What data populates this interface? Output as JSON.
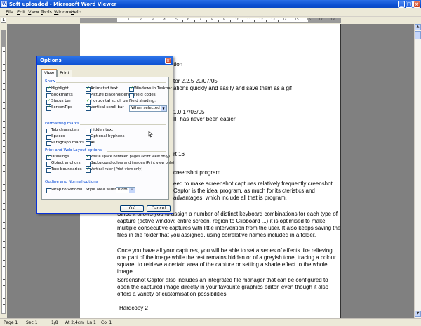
{
  "window": {
    "title": "Soft uploaded - Microsoft Word Viewer",
    "app_icon": "W",
    "buttons": {
      "minimize": "_",
      "maximize": "□",
      "close": "×"
    }
  },
  "menubar": [
    {
      "underline": "F",
      "rest": "ile"
    },
    {
      "underline": "E",
      "rest": "dit"
    },
    {
      "underline": "V",
      "rest": "iew"
    },
    {
      "underline": "T",
      "rest": "ools"
    },
    {
      "underline": "W",
      "rest": "indow"
    },
    {
      "underline": "H",
      "rest": "elp"
    }
  ],
  "ruler": {
    "corner": "L",
    "numbers": [
      "1",
      "2",
      "3",
      "4",
      "5",
      "6",
      "7",
      "8",
      "9",
      "10",
      "11",
      "12",
      "13",
      "14",
      "15",
      "16",
      "17",
      "18"
    ]
  },
  "document": {
    "lines": [
      "ormation",
      "tor 2.2.5 20/07/05",
      "ations quickly and easily and save them as a gif",
      "1.0 17/03/05",
      "IF has never been easier",
      "rt 16",
      "creenshot program"
    ],
    "para1": "eed to make screenshot captures relatively frequently creenshot Captor is the ideal program, as much for its cteristics and advantages, which include all that is program.",
    "para2": "Since it allows you to assign a number of distinct keyboard combinations for each type of capture (active window, entire screen, region to Clipboard ...) it is optimised to make multiple consecutive captures with little intervention from the user. It also keeps saving the files in the folder that you assigned, using correlative names included in a folder.",
    "para3": "Once you have all your captures, you will be able to set a series of effects like relieving one part of the image while the rest remains hidden or of a greyish tone, tracing a colour square, to retrieve a certain area of the capture or setting a shade effect to the whole image.",
    "para4": "Screenshot Captor also includes an integrated file manager that can be configured to open the captured image directly in your favourite graphics editor, even though it also offers a variety of customisation possibilities.",
    "heading": "Hardcopy 2"
  },
  "scrollbar": {
    "up": "▲",
    "down": "▼"
  },
  "dialog": {
    "title": "Options",
    "close": "×",
    "tabs": [
      "View",
      "Print"
    ],
    "show": {
      "label": "Show",
      "col1": [
        {
          "label": "Highlight",
          "checked": true
        },
        {
          "label": "Bookmarks",
          "checked": false
        },
        {
          "label": "Status bar",
          "checked": true
        },
        {
          "label": "ScreenTips",
          "checked": true
        }
      ],
      "col2": [
        {
          "label": "Animated text",
          "checked": true
        },
        {
          "label": "Picture placeholders",
          "checked": false
        },
        {
          "label": "Horizontal scroll bar",
          "checked": true
        },
        {
          "label": "Vertical scroll bar",
          "checked": true
        }
      ],
      "col3": [
        {
          "label": "Windows in Taskbar",
          "checked": true
        },
        {
          "label": "Field codes",
          "checked": false
        }
      ],
      "field_shading_label": "Field shading:",
      "field_shading_value": "When selected"
    },
    "formatting": {
      "label": "Formatting marks",
      "col1": [
        {
          "label": "Tab characters",
          "checked": false
        },
        {
          "label": "Spaces",
          "checked": false
        },
        {
          "label": "Paragraph marks",
          "checked": false
        }
      ],
      "col2": [
        {
          "label": "Hidden text",
          "checked": false
        },
        {
          "label": "Optional hyphens",
          "checked": false
        },
        {
          "label": "All",
          "checked": false
        }
      ]
    },
    "print_web": {
      "label": "Print and Web Layout options",
      "col1": [
        {
          "label": "Drawings",
          "checked": true
        },
        {
          "label": "Object anchors",
          "checked": false
        },
        {
          "label": "Text boundaries",
          "checked": false
        }
      ],
      "col2": [
        {
          "label": "White space between pages (Print view only)",
          "checked": true
        },
        {
          "label": "Background colors and images (Print view only)",
          "checked": false
        },
        {
          "label": "Vertical ruler (Print view only)",
          "checked": true
        }
      ]
    },
    "outline": {
      "label": "Outline and Normal options",
      "wrap": {
        "label": "Wrap to window",
        "checked": false
      },
      "style_area_label": "Style area width:",
      "style_area_value": "0 cm"
    },
    "ok": "OK",
    "cancel": "Cancel"
  },
  "status": {
    "page": "Page 1",
    "sec": "Sec 1",
    "pages": "1/8",
    "at": "At 2,4cm",
    "ln": "Ln 1",
    "col": "Col 1"
  }
}
